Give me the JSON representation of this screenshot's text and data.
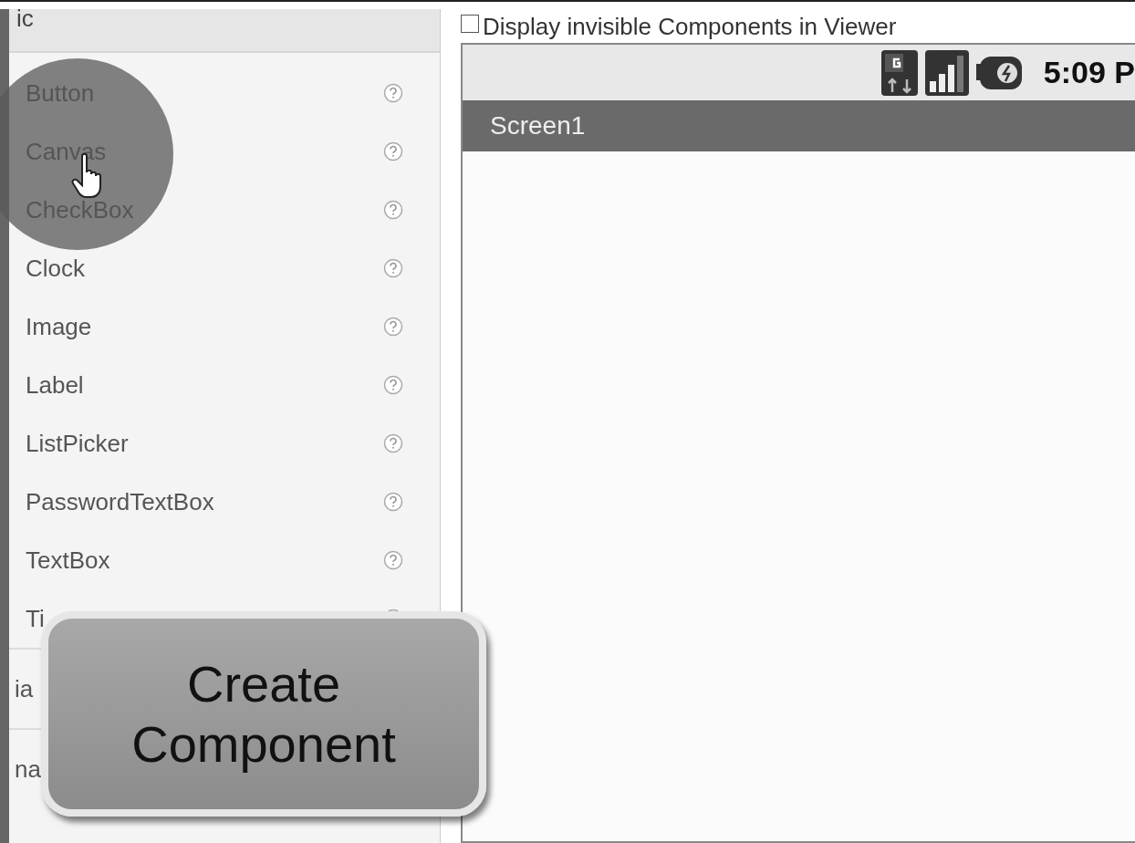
{
  "palette": {
    "header": "ic",
    "items": [
      {
        "label": "Button"
      },
      {
        "label": "Canvas"
      },
      {
        "label": "CheckBox"
      },
      {
        "label": "Clock"
      },
      {
        "label": "Image"
      },
      {
        "label": "Label"
      },
      {
        "label": "ListPicker"
      },
      {
        "label": "PasswordTextBox"
      },
      {
        "label": "TextBox"
      },
      {
        "label": "Ti"
      }
    ],
    "sections": [
      "ia",
      "na"
    ]
  },
  "viewer": {
    "checkbox": {
      "label": "Display invisible Components in Viewer",
      "checked": false
    },
    "status_time": "5:09 P",
    "screen_title": "Screen1"
  },
  "callout": {
    "text": "Create Component"
  }
}
